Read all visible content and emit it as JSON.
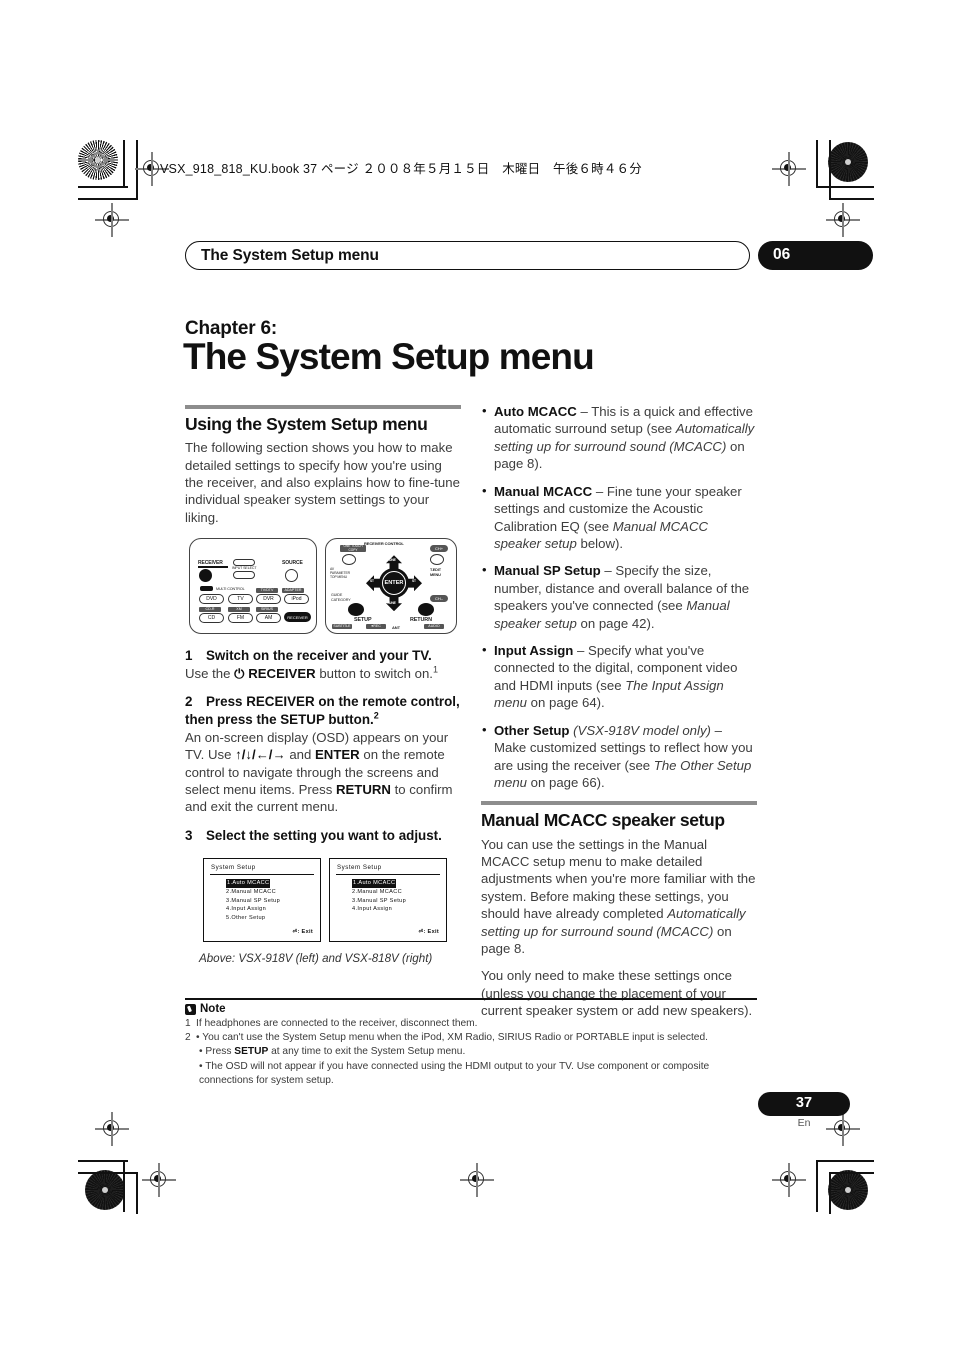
{
  "print_header": "VSX_918_818_KU.book  37 ページ  ２００８年５月１５日　木曜日　午後６時４６分",
  "running_head": {
    "title": "The System Setup menu",
    "chapter_number": "06"
  },
  "chapter": {
    "label": "Chapter 6:",
    "title": "The System Setup menu"
  },
  "left_column": {
    "section_heading": "Using the System Setup menu",
    "intro": "The following section shows you how to make detailed settings to specify how you're using the receiver, and also explains how to fine-tune individual speaker system settings to your liking.",
    "steps": [
      {
        "num": "1",
        "head": "Switch on the receiver and your TV.",
        "body_pre": "Use the ",
        "body_bold": "RECEIVER",
        "body_post": " button to switch on.",
        "footnote_ref": "1",
        "power_glyph": "⏻"
      },
      {
        "num": "2",
        "head": "Press RECEIVER on the remote control, then press the SETUP button.",
        "footnote_ref": "2",
        "body_1": "An on-screen display (OSD) appears on your TV. Use ",
        "arrows": "↑/↓/←/→",
        "body_2": " and ",
        "enter_bold": "ENTER",
        "body_3": " on the remote control to navigate through the screens and select menu items. Press ",
        "return_bold": "RETURN",
        "body_4": " to confirm and exit the current menu."
      },
      {
        "num": "3",
        "head": "Select the setting you want to adjust."
      }
    ],
    "remote_left": {
      "receiver_label": "RECEIVER",
      "source_label": "SOURCE",
      "input_select_label": "INPUT SELECT",
      "multi_control_label": "MULTI CONTROL",
      "buttons": [
        "DVD",
        "TV",
        "DVR",
        "iPod",
        "CD",
        "FM",
        "AM",
        "RECEIVER"
      ],
      "tags": [
        "TV/DTV",
        "ADAPTER",
        "CD-R",
        "XM",
        "SIRIUS"
      ]
    },
    "remote_right": {
      "top_label": "RECEIVER CONTROL",
      "one_touch": "ONE TOUCH COPY",
      "ch_plus": "CH+",
      "ch_minus": "CH–",
      "av_parameter": "AV PARAMETER TOP MENU",
      "t_edit": "T.EDIT MENU",
      "guide": "GUIDE CATEGORY",
      "enter": "ENTER",
      "setup": "SETUP",
      "return": "RETURN",
      "tune_up": "TUNE",
      "tune_down": "TUNE",
      "st_left": "ST",
      "st_right": "ST",
      "bottom_tags": [
        "SUBTITLE",
        "●REC",
        "ANT",
        "AUDIO"
      ]
    },
    "osd_screens": [
      {
        "title": "System  Setup",
        "items": [
          "1.Auto  MCACC",
          "2.Manual  MCACC",
          "3.Manual  SP  Setup",
          "4.Input  Assign",
          "5.Other  Setup"
        ],
        "selected_index": 0,
        "exit": ": Exit",
        "exit_glyph": "⏎"
      },
      {
        "title": "System  Setup",
        "items": [
          "1.Auto  MCACC",
          "2.Manual  MCACC",
          "3.Manual  SP  Setup",
          "4.Input  Assign"
        ],
        "selected_index": 0,
        "exit": ": Exit",
        "exit_glyph": "⏎"
      }
    ],
    "figure_caption": "Above: VSX-918V (left) and VSX-818V (right)"
  },
  "right_column": {
    "bullets": [
      {
        "term": "Auto MCACC",
        "dash": " – ",
        "text_a": "This is a quick and effective automatic surround setup (see ",
        "italic_a": "Automatically setting up for surround sound (MCACC)",
        "text_b": " on page 8)."
      },
      {
        "term": "Manual MCACC",
        "dash": " – ",
        "text_a": "Fine tune your speaker settings and customize the Acoustic Calibration EQ (see ",
        "italic_a": "Manual MCACC speaker setup",
        "text_b": " below)."
      },
      {
        "term": "Manual SP Setup",
        "dash": " – ",
        "text_a": "Specify the size, number, distance and overall balance of the speakers you've connected (see ",
        "italic_a": "Manual speaker setup",
        "text_b": " on page 42)."
      },
      {
        "term": "Input Assign",
        "dash": " – ",
        "text_a": "Specify what you've connected to the digital, component video and HDMI inputs (see ",
        "italic_a": "The Input Assign menu",
        "text_b": " on page 64)."
      },
      {
        "term": "Other Setup",
        "term_italic": " (VSX-918V model only)",
        "dash": " – ",
        "text_a": "Make customized settings to reflect how you are using the receiver (see ",
        "italic_a": "The Other Setup menu",
        "text_b": " on page 66)."
      }
    ],
    "section_heading": "Manual MCACC speaker setup",
    "para_1_a": "You can use the settings in the Manual MCACC setup menu to make detailed adjustments when you're more familiar with the system. Before making these settings, you should have already completed ",
    "para_1_italic": "Automatically setting up for surround sound (MCACC)",
    "para_1_b": " on page 8.",
    "para_2": "You only need to make these settings once (unless you change the placement of your current speaker system or add new speakers)."
  },
  "note": {
    "title": "Note",
    "lines": [
      {
        "lead": "1",
        "text": "If headphones are connected to the receiver, disconnect them."
      },
      {
        "lead": "2",
        "text": "• You can't use the System Setup menu when the iPod, XM Radio, SIRIUS Radio or PORTABLE input is selected."
      },
      {
        "lead": "",
        "text": "• Press SETUP at any time to exit the System Setup menu.",
        "bold_word": "SETUP"
      },
      {
        "lead": "",
        "text": "• The OSD will not appear if you have connected using the HDMI output to your TV. Use component or composite connections for system setup."
      }
    ]
  },
  "footer": {
    "page_number": "37",
    "language": "En"
  },
  "colors": {
    "ink": "#111111",
    "body_gray": "#3d3d3d",
    "rule_gray": "#8d8d8d"
  }
}
